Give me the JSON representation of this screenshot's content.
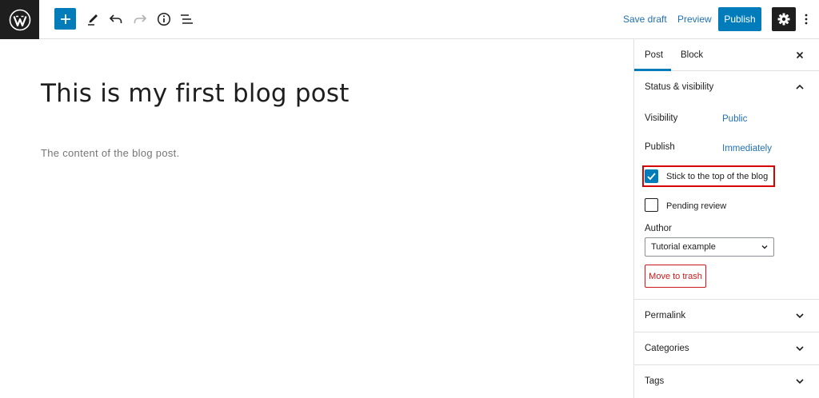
{
  "toolbar": {
    "save_draft": "Save draft",
    "preview": "Preview",
    "publish": "Publish"
  },
  "icons": {
    "logo": "wordpress-logo",
    "add": "plus-icon",
    "tools": "pencil-icon",
    "undo": "undo-icon",
    "redo": "redo-icon",
    "info": "info-icon",
    "outline": "list-view-icon",
    "settings": "gear-icon",
    "more": "more-vertical-icon"
  },
  "editor": {
    "title": "This is my first blog post",
    "content": "The content of the blog post."
  },
  "sidebar": {
    "tabs": [
      "Post",
      "Block"
    ],
    "active_tab": "Post",
    "status_panel": {
      "title": "Status & visibility",
      "visibility_label": "Visibility",
      "visibility_value": "Public",
      "publish_label": "Publish",
      "publish_value": "Immediately",
      "sticky_label": "Stick to the top of the blog",
      "sticky_checked": true,
      "pending_label": "Pending review",
      "pending_checked": false,
      "author_label": "Author",
      "author_value": "Tutorial example",
      "trash_label": "Move to trash"
    },
    "panels": [
      "Permalink",
      "Categories",
      "Tags"
    ]
  },
  "colors": {
    "accent": "#007cba",
    "link": "#2271b1",
    "danger": "#cc1818",
    "highlight_box": "#d50000"
  }
}
